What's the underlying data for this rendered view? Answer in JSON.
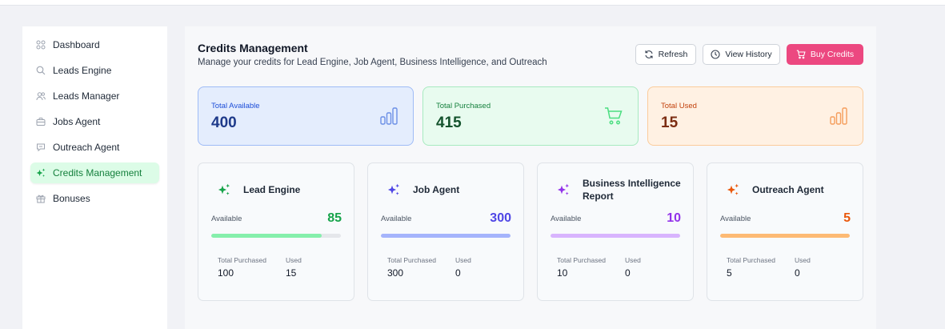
{
  "colors": {
    "brand_pink": "#ec4880",
    "active_green": "#15803d",
    "lead_engine": "#16a34a",
    "job_agent": "#4f46e5",
    "business_intelligence": "#9333ea",
    "outreach_agent": "#ea580c"
  },
  "sidebar": {
    "items": [
      {
        "label": "Dashboard",
        "icon": "grid-icon"
      },
      {
        "label": "Leads Engine",
        "icon": "search-icon"
      },
      {
        "label": "Leads Manager",
        "icon": "users-icon"
      },
      {
        "label": "Jobs Agent",
        "icon": "briefcase-icon"
      },
      {
        "label": "Outreach Agent",
        "icon": "chat-icon"
      },
      {
        "label": "Credits Management",
        "icon": "sparkles-icon",
        "active": true
      },
      {
        "label": "Bonuses",
        "icon": "gift-icon"
      }
    ]
  },
  "header": {
    "title": "Credits Management",
    "subtitle": "Manage your credits for Lead Engine, Job Agent, Business Intelligence, and Outreach"
  },
  "actions": {
    "refresh_label": "Refresh",
    "history_label": "View History",
    "buy_label": "Buy Credits"
  },
  "stats": {
    "available": {
      "label": "Total Available",
      "value": "400",
      "icon": "bar-chart-icon"
    },
    "purchased": {
      "label": "Total Purchased",
      "value": "415",
      "icon": "cart-icon"
    },
    "used": {
      "label": "Total Used",
      "value": "15",
      "icon": "bar-chart-icon"
    }
  },
  "cards": [
    {
      "title": "Lead Engine",
      "available_label": "Available",
      "available": "85",
      "purchased_label": "Total Purchased",
      "purchased": "100",
      "used_label": "Used",
      "used": "15",
      "fill": 0.85
    },
    {
      "title": "Job Agent",
      "available_label": "Available",
      "available": "300",
      "purchased_label": "Total Purchased",
      "purchased": "300",
      "used_label": "Used",
      "used": "0",
      "fill": 1.0
    },
    {
      "title": "Business Intelligence Report",
      "available_label": "Available",
      "available": "10",
      "purchased_label": "Total Purchased",
      "purchased": "10",
      "used_label": "Used",
      "used": "0",
      "fill": 1.0
    },
    {
      "title": "Outreach Agent",
      "available_label": "Available",
      "available": "5",
      "purchased_label": "Total Purchased",
      "purchased": "5",
      "used_label": "Used",
      "used": "0",
      "fill": 1.0
    }
  ]
}
